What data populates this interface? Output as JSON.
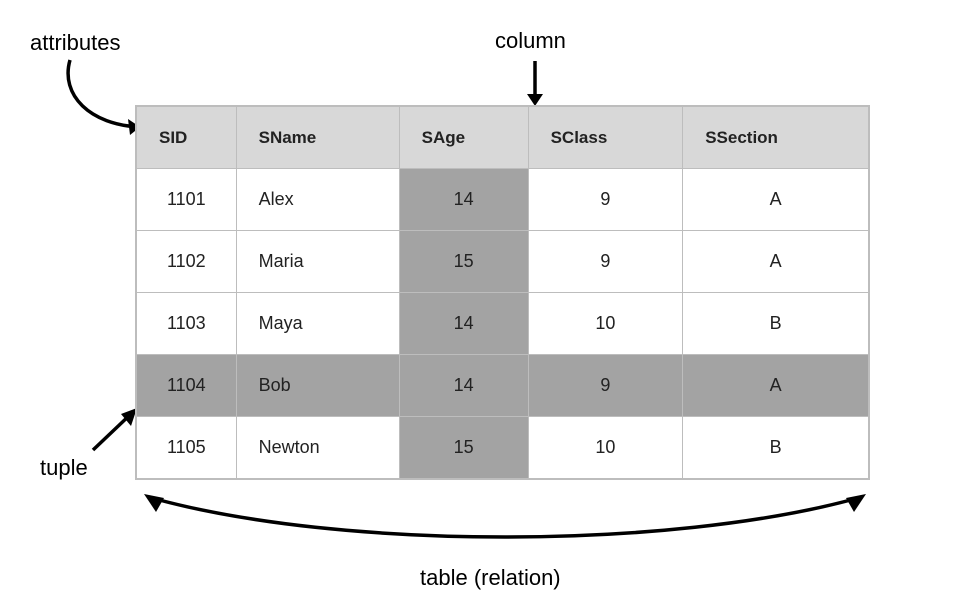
{
  "labels": {
    "attributes": "attributes",
    "column": "column",
    "tuple": "tuple",
    "table_relation": "table (relation)"
  },
  "headers": [
    "SID",
    "SName",
    "SAge",
    "SClass",
    "SSection"
  ],
  "rows": [
    {
      "sid": "1101",
      "sname": "Alex",
      "sage": "14",
      "sclass": "9",
      "ssection": "A",
      "highlight": false
    },
    {
      "sid": "1102",
      "sname": "Maria",
      "sage": "15",
      "sclass": "9",
      "ssection": "A",
      "highlight": false
    },
    {
      "sid": "1103",
      "sname": "Maya",
      "sage": "14",
      "sclass": "10",
      "ssection": "B",
      "highlight": false
    },
    {
      "sid": "1104",
      "sname": "Bob",
      "sage": "14",
      "sclass": "9",
      "ssection": "A",
      "highlight": true
    },
    {
      "sid": "1105",
      "sname": "Newton",
      "sage": "15",
      "sclass": "10",
      "ssection": "B",
      "highlight": false
    }
  ],
  "highlight_column_index": 2
}
